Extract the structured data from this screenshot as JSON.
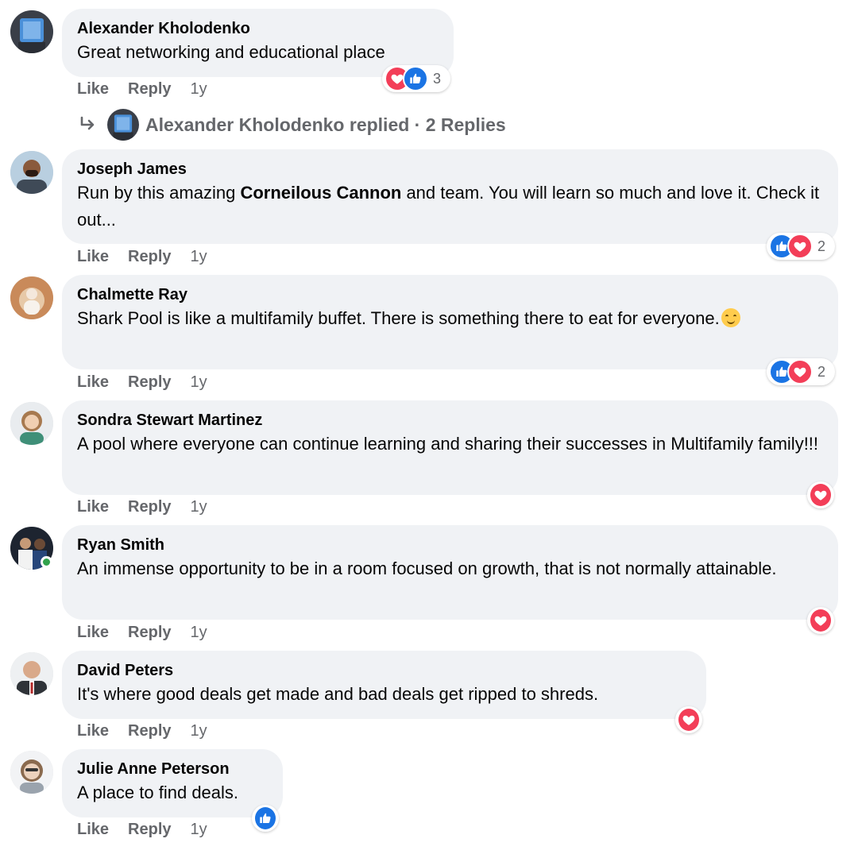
{
  "actions": {
    "like": "Like",
    "reply": "Reply"
  },
  "colors": {
    "bubble": "#f0f2f5",
    "like_blue": "#1b74e4",
    "love_red": "#f33e58",
    "meta_gray": "#65676b"
  },
  "comments": [
    {
      "author": "Alexander Kholodenko",
      "text": "Great networking and educational place",
      "time": "1y",
      "reactions": [
        "love-icon",
        "like-icon"
      ],
      "reaction_count": "3",
      "replies_label": "Alexander Kholodenko replied · 2 Replies"
    },
    {
      "author": "Joseph James",
      "text_before": "Run by this amazing ",
      "text_bold": "Corneilous Cannon",
      "text_after": " and team. You will learn so much and love it. Check it out...",
      "time": "1y",
      "reactions": [
        "like-icon",
        "love-icon"
      ],
      "reaction_count": "2"
    },
    {
      "author": "Chalmette Ray",
      "text": "Shark Pool is like a multifamily buffet. There is something there to eat for everyone.",
      "emoji": "smiling-face-emoji",
      "time": "1y",
      "reactions": [
        "like-icon",
        "love-icon"
      ],
      "reaction_count": "2"
    },
    {
      "author": "Sondra Stewart Martinez",
      "text": "A pool where everyone can continue learning and sharing their successes in Multifamily family!!!",
      "time": "1y",
      "reactions": [
        "love-icon"
      ]
    },
    {
      "author": "Ryan Smith",
      "text": "An immense opportunity to be in a room focused on growth, that is not normally attainable.",
      "time": "1y",
      "online": true,
      "reactions": [
        "love-icon"
      ]
    },
    {
      "author": "David Peters",
      "text": "It's where good deals get made and bad deals get ripped to shreds.",
      "time": "1y",
      "reactions": [
        "love-icon"
      ]
    },
    {
      "author": "Julie Anne Peterson",
      "text": "A place to find deals.",
      "time": "1y",
      "reactions": [
        "like-icon"
      ]
    }
  ]
}
